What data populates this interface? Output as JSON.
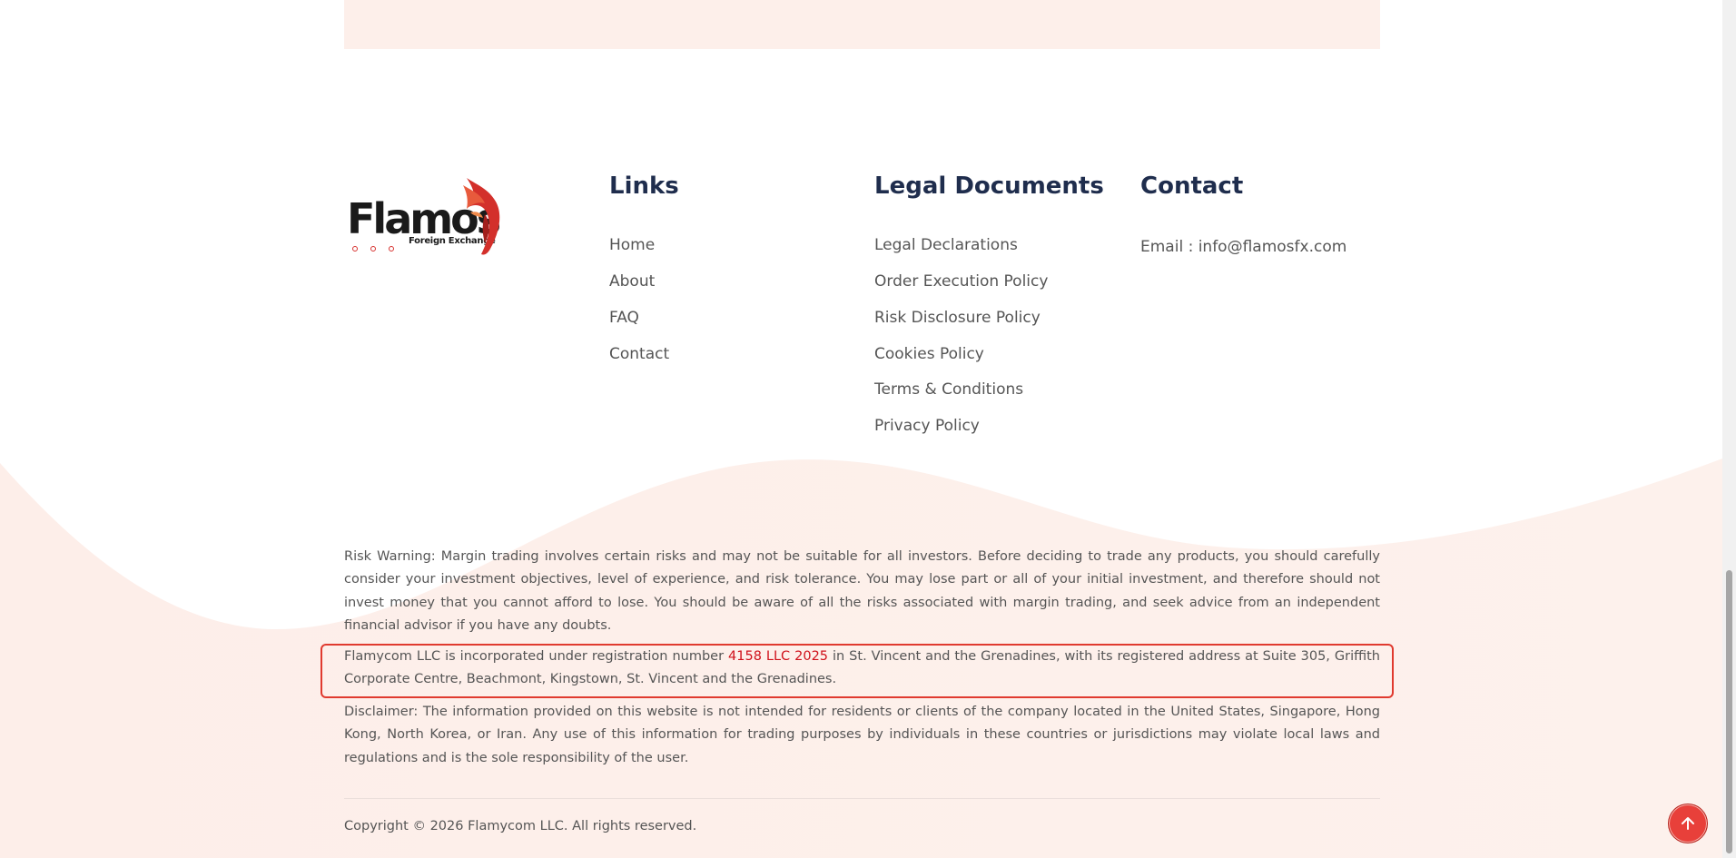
{
  "logo": {
    "word": "Flamos",
    "subtitle": "Foreign Exchange"
  },
  "columns": {
    "links": {
      "title": "Links",
      "items": [
        "Home",
        "About",
        "FAQ",
        "Contact"
      ]
    },
    "legal": {
      "title": "Legal Documents",
      "items": [
        "Legal Declarations",
        "Order Execution Policy",
        "Risk Disclosure Policy",
        "Cookies Policy",
        "Terms & Conditions",
        "Privacy Policy"
      ]
    },
    "contact": {
      "title": "Contact",
      "email": "Email : info@flamosfx.com"
    }
  },
  "notices": {
    "risk_warning": "Risk Warning: Margin trading involves certain risks and may not be suitable for all investors. Before deciding to trade any products, you should carefully consider your investment objectives, level of experience, and risk tolerance. You may lose part or all of your initial investment, and therefore should not invest money that you cannot afford to lose. You should be aware of all the risks associated with margin trading, and seek advice from an independent financial advisor if you have any doubts.",
    "registration_prefix": "Flamycom LLC is incorporated under registration number ",
    "registration_number": "4158 LLC 2025",
    "registration_suffix": " in St. Vincent and the Grenadines, with its registered address at Suite 305, Griffith Corporate Centre, Beachmont, Kingstown, St. Vincent and the Grenadines.",
    "disclaimer": "Disclaimer: The information provided on this website is not intended for residents or clients of the company located in the United States, Singapore, Hong Kong, North Korea, or Iran. Any use of this information for trading purposes by individuals in these countries or jurisdictions may violate local laws and regulations and is the sole responsibility of the user."
  },
  "copyright": "Copyright © 2026 Flamycom LLC. All rights reserved.",
  "colors": {
    "accent": "#e8403a",
    "heading": "#1f2d4d",
    "highlight": "#d0121b",
    "background_tint": "#fdefea"
  },
  "icons": {
    "back_to_top": "arrow-up-icon"
  }
}
